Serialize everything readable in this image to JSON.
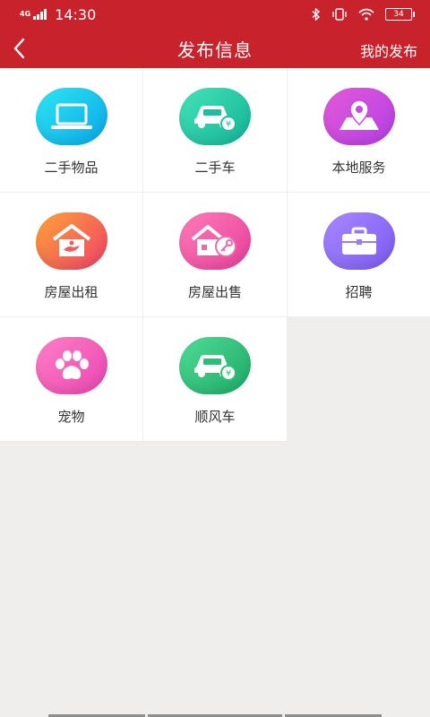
{
  "status_bar": {
    "network": "4G",
    "time": "14:30",
    "battery": "34"
  },
  "header": {
    "title": "发布信息",
    "right_action": "我的发布"
  },
  "categories": [
    {
      "label": "二手物品",
      "icon": "laptop-icon",
      "color": "#0aa7e8"
    },
    {
      "label": "二手车",
      "icon": "car-yuan-icon",
      "color": "#13b497"
    },
    {
      "label": "本地服务",
      "icon": "map-pin-icon",
      "color": "#b43fe5"
    },
    {
      "label": "房屋出租",
      "icon": "house-hand-icon",
      "color": "#f0406a"
    },
    {
      "label": "房屋出售",
      "icon": "house-key-icon",
      "color": "#e8409a"
    },
    {
      "label": "招聘",
      "icon": "briefcase-icon",
      "color": "#7a5bf0"
    },
    {
      "label": "宠物",
      "icon": "paw-icon",
      "color": "#e946b0"
    },
    {
      "label": "顺风车",
      "icon": "car-yuan-icon",
      "color": "#1eaa66"
    }
  ],
  "colors": {
    "brand_red": "#c8232c",
    "page_bg": "#efeeec"
  }
}
